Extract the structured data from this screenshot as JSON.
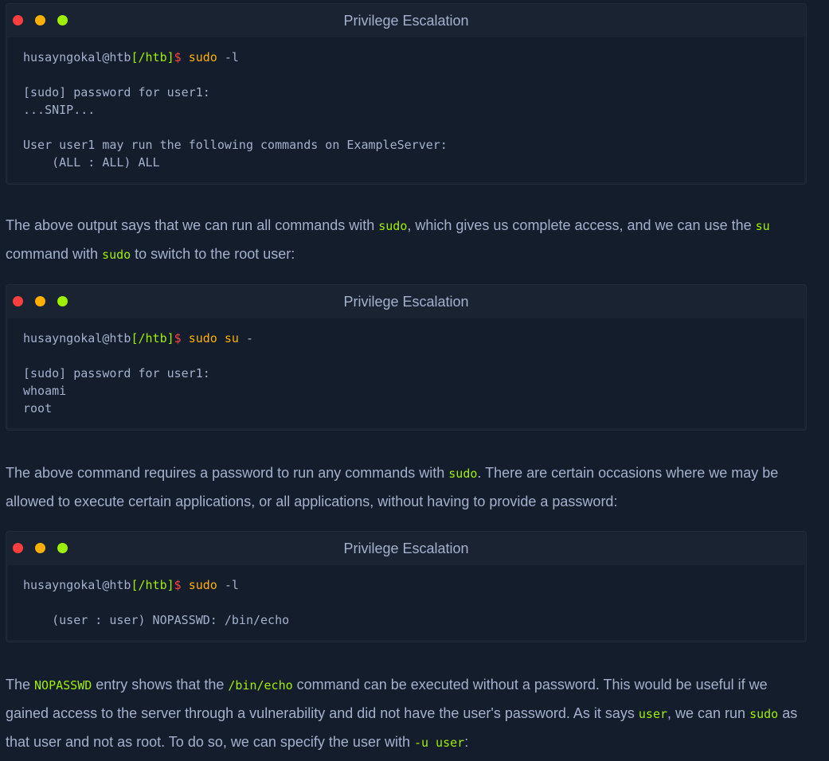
{
  "blocks": [
    {
      "title": "Privilege Escalation",
      "prompt": {
        "user": "husayngokal@htb",
        "path": "[/htb]",
        "dollar": "$",
        "cmd": "sudo",
        "args": " -l"
      },
      "output": [
        "",
        "[sudo] password for user1:",
        "...SNIP...",
        "",
        "User user1 may run the following commands on ExampleServer:",
        "    (ALL : ALL) ALL"
      ]
    },
    {
      "title": "Privilege Escalation",
      "prompt": {
        "user": "husayngokal@htb",
        "path": "[/htb]",
        "dollar": "$",
        "cmd": "sudo su",
        "args": " -"
      },
      "output": [
        "",
        "[sudo] password for user1:",
        "whoami",
        "root"
      ]
    },
    {
      "title": "Privilege Escalation",
      "prompt": {
        "user": "husayngokal@htb",
        "path": "[/htb]",
        "dollar": "$",
        "cmd": "sudo",
        "args": " -l"
      },
      "output": [
        "",
        "    (user : user) NOPASSWD: /bin/echo"
      ]
    }
  ],
  "paragraphs": {
    "p1": {
      "t1": "The above output says that we can run all commands with ",
      "c1": "sudo",
      "t2": ", which gives us complete access, and we can use the ",
      "c2": "su",
      "t3": " command with ",
      "c3": "sudo",
      "t4": " to switch to the root user:"
    },
    "p2": {
      "t1": "The above command requires a password to run any commands with ",
      "c1": "sudo",
      "t2": ". There are certain occasions where we may be allowed to execute certain applications, or all applications, without having to provide a password:"
    },
    "p3": {
      "t1": "The ",
      "c1": "NOPASSWD",
      "t2": " entry shows that the ",
      "c2": "/bin/echo",
      "t3": " command can be executed without a password. This would be useful if we gained access to the server through a vulnerability and did not have the user's password. As it says ",
      "c3": "user",
      "t4": ", we can run ",
      "c4": "sudo",
      "t5": " as that user and not as root. To do so, we can specify the user with ",
      "c5": "-u user",
      "t6": ":"
    }
  },
  "colors": {
    "background": "#141d2b",
    "panel": "#1a2332",
    "text": "#a4b1cd",
    "green": "#9fef00",
    "orange": "#ffaf00",
    "red": "#ff3e3e"
  }
}
